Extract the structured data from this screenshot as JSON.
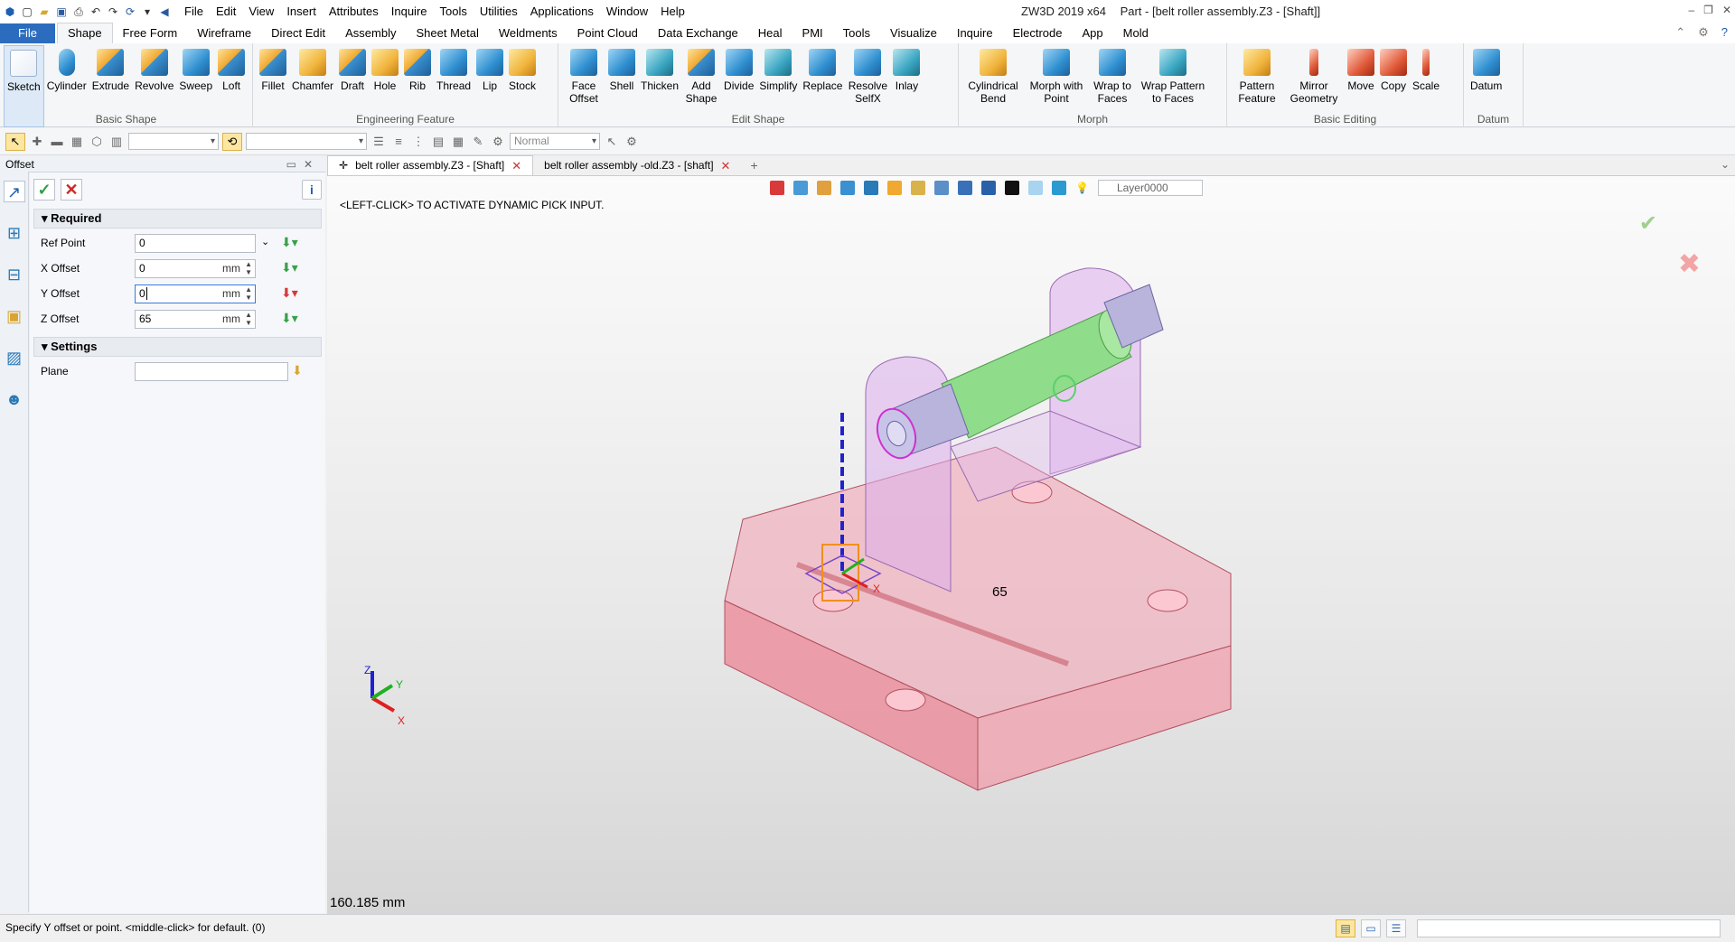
{
  "app": {
    "product": "ZW3D 2019  x64",
    "title": "Part - [belt roller assembly.Z3 - [Shaft]]",
    "window_controls": [
      "–",
      "❐",
      "✕"
    ]
  },
  "menu": [
    "File",
    "Edit",
    "View",
    "Insert",
    "Attributes",
    "Inquire",
    "Tools",
    "Utilities",
    "Applications",
    "Window",
    "Help"
  ],
  "ribbon_tabs": [
    "File",
    "Shape",
    "Free Form",
    "Wireframe",
    "Direct Edit",
    "Assembly",
    "Sheet Metal",
    "Weldments",
    "Point Cloud",
    "Data Exchange",
    "Heal",
    "PMI",
    "Tools",
    "Visualize",
    "Inquire",
    "Electrode",
    "App",
    "Mold"
  ],
  "active_tab": "Shape",
  "groups": {
    "basic_shape": {
      "label": "Basic Shape",
      "buttons": [
        "Sketch",
        "Cylinder",
        "Extrude",
        "Revolve",
        "Sweep",
        "Loft"
      ]
    },
    "engineering": {
      "label": "Engineering Feature",
      "buttons": [
        "Fillet",
        "Chamfer",
        "Draft",
        "Hole",
        "Rib",
        "Thread",
        "Lip",
        "Stock"
      ]
    },
    "edit_shape": {
      "label": "Edit Shape",
      "buttons": [
        "Face Offset",
        "Shell",
        "Thicken",
        "Add Shape",
        "Divide",
        "Simplify",
        "Replace",
        "Resolve SelfX",
        "Inlay"
      ]
    },
    "morph": {
      "label": "Morph",
      "buttons": [
        "Cylindrical Bend",
        "Morph with Point",
        "Wrap to Faces",
        "Wrap Pattern to Faces"
      ]
    },
    "basic_editing": {
      "label": "Basic Editing",
      "buttons": [
        "Pattern Feature",
        "Mirror Geometry",
        "Move",
        "Copy",
        "Scale"
      ]
    },
    "datum": {
      "label": "Datum",
      "buttons": [
        "Datum"
      ]
    }
  },
  "toolbar": {
    "render_mode": "Normal"
  },
  "panel": {
    "title": "Offset",
    "required_label": "Required",
    "settings_label": "Settings",
    "fields": {
      "ref_point": {
        "label": "Ref Point",
        "value": "0"
      },
      "x_offset": {
        "label": "X Offset",
        "value": "0",
        "unit": "mm"
      },
      "y_offset": {
        "label": "Y Offset",
        "value": "0",
        "unit": "mm"
      },
      "z_offset": {
        "label": "Z Offset",
        "value": "65",
        "unit": "mm"
      },
      "plane": {
        "label": "Plane",
        "value": ""
      }
    }
  },
  "doc_tabs": [
    {
      "label": "belt roller assembly.Z3 - [Shaft]",
      "active": true
    },
    {
      "label": "belt roller assembly -old.Z3 - [shaft]",
      "active": false
    }
  ],
  "viewport": {
    "message": "<LEFT-CLICK> TO ACTIVATE DYNAMIC PICK INPUT.",
    "layer": "Layer0000",
    "readout": "160.185 mm",
    "dimension": "65",
    "axes": {
      "x": "X",
      "y": "Y",
      "z": "Z"
    }
  },
  "status": {
    "text": "Specify Y offset or point.  <middle-click> for default. (0)"
  },
  "colors": {
    "accent": "#2b6cbf",
    "base": "#f08a9a",
    "shaft": "#8fdc8a",
    "bracket": "#d9a8e8"
  }
}
